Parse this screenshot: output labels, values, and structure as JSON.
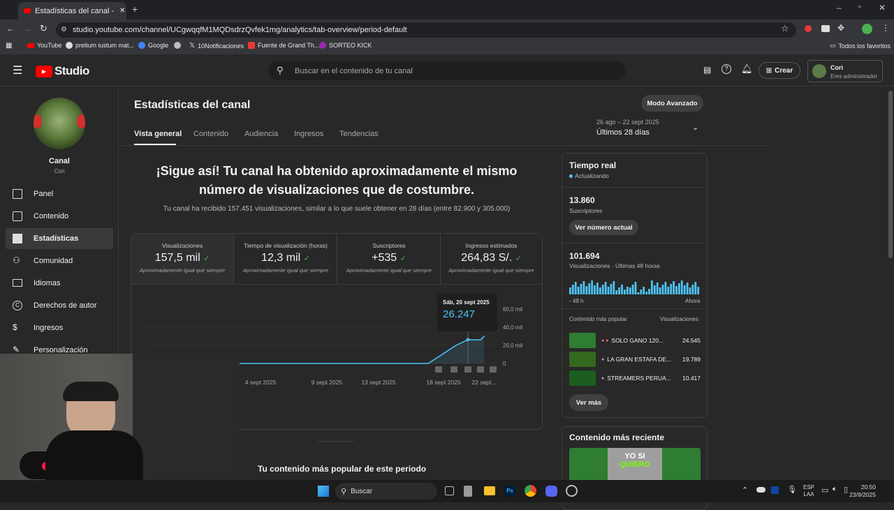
{
  "browser": {
    "tab_title": "Estadísticas del canal - YouTube",
    "url": "studio.youtube.com/channel/UCgwqqfM1MQDsdrzQvfek1mg/analytics/tab-overview/period-default",
    "bookmarks": [
      "YouTube",
      "pretium iustum mat...",
      "Google",
      "",
      "10Notificaciones",
      "Fuente de Grand Th...",
      "SORTEO KICK"
    ],
    "all_favorites": "Todos los favoritos"
  },
  "header": {
    "logo": "Studio",
    "search_placeholder": "Buscar en el contenido de tu canal",
    "create_label": "Crear",
    "account_name": "Cori",
    "account_role": "Eres administrador"
  },
  "sidebar": {
    "channel_label": "Canal",
    "channel_name": "Cori",
    "items": [
      {
        "label": "Panel",
        "icon": "dashboard-icon"
      },
      {
        "label": "Contenido",
        "icon": "content-icon"
      },
      {
        "label": "Estadísticas",
        "icon": "analytics-icon"
      },
      {
        "label": "Comunidad",
        "icon": "community-icon"
      },
      {
        "label": "Idiomas",
        "icon": "subtitles-icon"
      },
      {
        "label": "Derechos de autor",
        "icon": "copyright-icon"
      },
      {
        "label": "Ingresos",
        "icon": "dollar-icon"
      },
      {
        "label": "Personalización",
        "icon": "brush-icon"
      }
    ]
  },
  "main": {
    "title": "Estadísticas del canal",
    "advanced_mode": "Modo Avanzado",
    "date_range": "26 ago – 22 sept 2025",
    "period": "Últimos 28 días",
    "tabs": [
      "Vista general",
      "Contenido",
      "Audiencia",
      "Ingresos",
      "Tendencias"
    ],
    "headline_1": "¡Sigue así! Tu canal ha obtenido aproximadamente el mismo",
    "headline_2": "número de visualizaciones que de costumbre.",
    "subtext": "Tu canal ha recibido 157.451 visualizaciones, similar a lo que suele obtener en 28 días (entre 82.900 y 305.000)",
    "metrics": [
      {
        "label": "Visualizaciones",
        "value": "157,5 mil",
        "sub": "Aproximadamente igual que siempre"
      },
      {
        "label": "Tiempo de visualización (horas)",
        "value": "12,3 mil",
        "sub": "Aproximadamente igual que siempre"
      },
      {
        "label": "Suscriptores",
        "value": "+535",
        "sub": "Aproximadamente igual que siempre"
      },
      {
        "label": "Ingresos estimados",
        "value": "264,83 S/.",
        "sub": "Aproximadamente igual que siempre"
      }
    ],
    "tooltip_date": "Sáb, 20 sept 2025",
    "tooltip_value": "26.247",
    "popular_heading": "Tu contenido más popular de este periodo"
  },
  "chart_data": {
    "type": "line",
    "y_ticks": [
      "60,0 mil",
      "40,0 mil",
      "20,0 mil",
      "0"
    ],
    "x_ticks": [
      "4 sept 2025",
      "9 sept 2025",
      "13 sept 2025",
      "18 sept 2025",
      "22 sept..."
    ],
    "ylim": [
      0,
      60000
    ],
    "x": [
      "26 ago",
      "4 sept",
      "9 sept",
      "13 sept",
      "17 sept",
      "18 sept",
      "19 sept",
      "20 sept",
      "21 sept",
      "22 sept"
    ],
    "values": [
      0,
      0,
      0,
      0,
      0,
      10000,
      20000,
      26247,
      26000,
      30000
    ]
  },
  "realtime": {
    "title": "Tiempo real",
    "status": "Actualizando",
    "subs_value": "13.860",
    "subs_label": "Suscriptores",
    "see_actual": "Ver número actual",
    "views_value": "101.694",
    "views_label": "Visualizaciones · Últimas 48 horas",
    "left_axis": "- 48 h",
    "right_axis": "Ahora",
    "top_content_label": "Contenido más popular",
    "views_col": "Visualizaciones",
    "top_items": [
      {
        "title": "SOLO GANO 120...",
        "views": "24.545"
      },
      {
        "title": "LA GRAN ESTAFA DE...",
        "views": "19.789"
      },
      {
        "title": "STREAMERS PERUA...",
        "views": "10.417"
      }
    ],
    "see_more": "Ver más",
    "recent_title": "Contenido más reciente",
    "recent_thumb_text_1": "YO SI",
    "recent_thumb_text_2": "QUIERO"
  },
  "taskbar": {
    "search": "Buscar",
    "lang_1": "ESP",
    "lang_2": "LAA",
    "time": "20:50",
    "date": "23/9/2025"
  }
}
